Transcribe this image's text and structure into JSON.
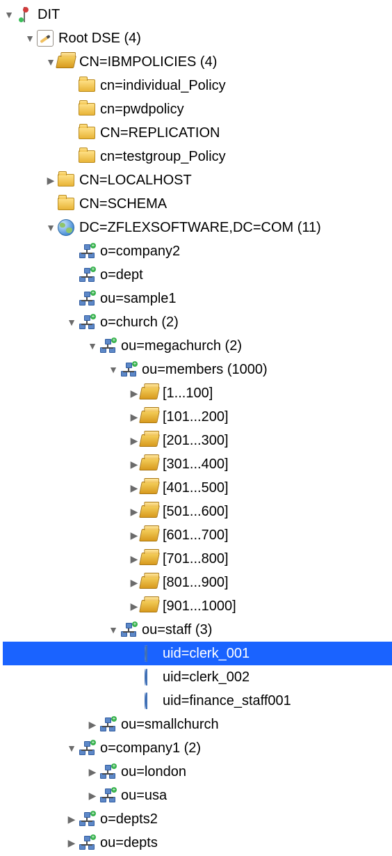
{
  "icons": {
    "dit": "dit-icon",
    "rootdse": "root-pencil",
    "folder": "folder",
    "folder-open": "folder-open",
    "org": "org",
    "globe": "globe",
    "person": "person"
  },
  "tree": [
    {
      "id": "dit",
      "level": 0,
      "twisty": "open",
      "icon": "dit",
      "label": "DIT",
      "interactable": true
    },
    {
      "id": "rootdse",
      "level": 1,
      "twisty": "open",
      "icon": "rootdse",
      "label": "Root DSE (4)",
      "interactable": true
    },
    {
      "id": "ibmpolicies",
      "level": 2,
      "twisty": "open",
      "icon": "folder-open",
      "label": "CN=IBMPOLICIES (4)",
      "interactable": true
    },
    {
      "id": "individual",
      "level": 3,
      "twisty": "none",
      "icon": "folder",
      "label": "cn=individual_Policy",
      "interactable": true
    },
    {
      "id": "pwdpolicy",
      "level": 3,
      "twisty": "none",
      "icon": "folder",
      "label": "cn=pwdpolicy",
      "interactable": true
    },
    {
      "id": "replication",
      "level": 3,
      "twisty": "none",
      "icon": "folder",
      "label": "CN=REPLICATION",
      "interactable": true
    },
    {
      "id": "testgroup",
      "level": 3,
      "twisty": "none",
      "icon": "folder",
      "label": "cn=testgroup_Policy",
      "interactable": true
    },
    {
      "id": "localhost",
      "level": 2,
      "twisty": "closed",
      "icon": "folder",
      "label": "CN=LOCALHOST",
      "interactable": true
    },
    {
      "id": "schema",
      "level": 2,
      "twisty": "none",
      "icon": "folder",
      "label": "CN=SCHEMA",
      "interactable": true
    },
    {
      "id": "dc",
      "level": 2,
      "twisty": "open",
      "icon": "globe",
      "label": "DC=ZFLEXSOFTWARE,DC=COM (11)",
      "interactable": true
    },
    {
      "id": "company2",
      "level": 3,
      "twisty": "none",
      "icon": "org",
      "label": "o=company2",
      "interactable": true
    },
    {
      "id": "dept",
      "level": 3,
      "twisty": "none",
      "icon": "org",
      "label": "o=dept",
      "interactable": true
    },
    {
      "id": "sample1",
      "level": 3,
      "twisty": "none",
      "icon": "org",
      "label": "ou=sample1",
      "interactable": true
    },
    {
      "id": "church",
      "level": 3,
      "twisty": "open",
      "icon": "org",
      "label": "o=church (2)",
      "interactable": true
    },
    {
      "id": "megachurch",
      "level": 4,
      "twisty": "open",
      "icon": "org",
      "label": "ou=megachurch (2)",
      "interactable": true
    },
    {
      "id": "members",
      "level": 5,
      "twisty": "open",
      "icon": "org",
      "label": "ou=members (1000)",
      "interactable": true
    },
    {
      "id": "r1",
      "level": 6,
      "twisty": "closed",
      "icon": "folder-open",
      "label": "[1...100]",
      "interactable": true
    },
    {
      "id": "r2",
      "level": 6,
      "twisty": "closed",
      "icon": "folder-open",
      "label": "[101...200]",
      "interactable": true
    },
    {
      "id": "r3",
      "level": 6,
      "twisty": "closed",
      "icon": "folder-open",
      "label": "[201...300]",
      "interactable": true
    },
    {
      "id": "r4",
      "level": 6,
      "twisty": "closed",
      "icon": "folder-open",
      "label": "[301...400]",
      "interactable": true
    },
    {
      "id": "r5",
      "level": 6,
      "twisty": "closed",
      "icon": "folder-open",
      "label": "[401...500]",
      "interactable": true
    },
    {
      "id": "r6",
      "level": 6,
      "twisty": "closed",
      "icon": "folder-open",
      "label": "[501...600]",
      "interactable": true
    },
    {
      "id": "r7",
      "level": 6,
      "twisty": "closed",
      "icon": "folder-open",
      "label": "[601...700]",
      "interactable": true
    },
    {
      "id": "r8",
      "level": 6,
      "twisty": "closed",
      "icon": "folder-open",
      "label": "[701...800]",
      "interactable": true
    },
    {
      "id": "r9",
      "level": 6,
      "twisty": "closed",
      "icon": "folder-open",
      "label": "[801...900]",
      "interactable": true
    },
    {
      "id": "r10",
      "level": 6,
      "twisty": "closed",
      "icon": "folder-open",
      "label": "[901...1000]",
      "interactable": true
    },
    {
      "id": "staff",
      "level": 5,
      "twisty": "open",
      "icon": "org",
      "label": "ou=staff (3)",
      "interactable": true
    },
    {
      "id": "clerk1",
      "level": 6,
      "twisty": "none",
      "icon": "person",
      "label": "uid=clerk_001",
      "interactable": true,
      "selected": true
    },
    {
      "id": "clerk2",
      "level": 6,
      "twisty": "none",
      "icon": "person",
      "label": "uid=clerk_002",
      "interactable": true
    },
    {
      "id": "fin",
      "level": 6,
      "twisty": "none",
      "icon": "person",
      "label": "uid=finance_staff001",
      "interactable": true
    },
    {
      "id": "smallchurch",
      "level": 4,
      "twisty": "closed",
      "icon": "org",
      "label": "ou=smallchurch",
      "interactable": true
    },
    {
      "id": "company1",
      "level": 3,
      "twisty": "open",
      "icon": "org",
      "label": "o=company1 (2)",
      "interactable": true
    },
    {
      "id": "london",
      "level": 4,
      "twisty": "closed",
      "icon": "org",
      "label": "ou=london",
      "interactable": true
    },
    {
      "id": "usa",
      "level": 4,
      "twisty": "closed",
      "icon": "org",
      "label": "ou=usa",
      "interactable": true
    },
    {
      "id": "depts2",
      "level": 3,
      "twisty": "closed",
      "icon": "org",
      "label": "o=depts2",
      "interactable": true
    },
    {
      "id": "deptsou",
      "level": 3,
      "twisty": "closed",
      "icon": "org",
      "label": "ou=depts",
      "interactable": true
    }
  ]
}
